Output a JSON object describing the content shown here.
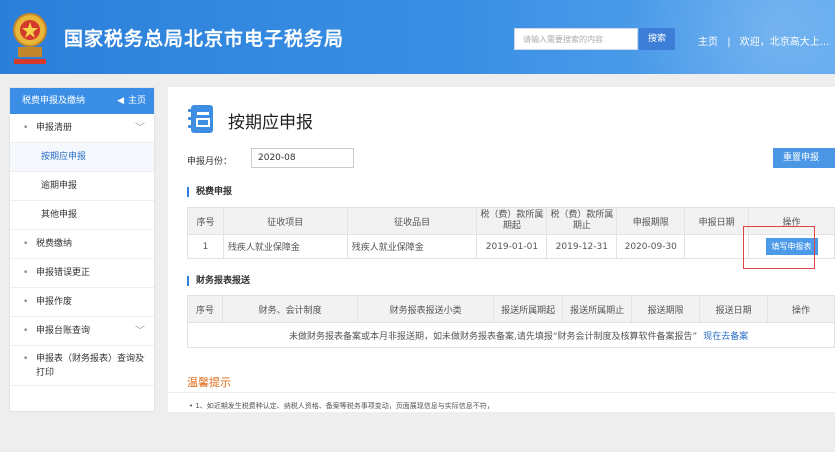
{
  "header": {
    "title": "国家税务总局北京市电子税务局",
    "search_placeholder": "请输入需要搜索的内容",
    "search_button": "搜索",
    "home_link": "主页",
    "separator": "|",
    "welcome": "欢迎，北京高大上...",
    "emblem_icon": "tax-emblem-icon"
  },
  "sidebar": {
    "head_label": "税费申报及缴纳",
    "home_label": "主页",
    "items": [
      {
        "label": "申报清册",
        "expanded": true
      },
      {
        "label": "按期应申报",
        "sub": true,
        "active": true
      },
      {
        "label": "逾期申报",
        "sub": true
      },
      {
        "label": "其他申报",
        "sub": true
      },
      {
        "label": "税费缴纳"
      },
      {
        "label": "申报错误更正"
      },
      {
        "label": "申报作废"
      },
      {
        "label": "申报台账查询"
      },
      {
        "label": "申报表（财务报表）查询及打印"
      }
    ]
  },
  "main": {
    "page_title": "按期应申报",
    "period_label": "申报月份：",
    "period_value": "2020-08",
    "reset_button": "重置申报",
    "tax_section_title": "税费申报",
    "tax_table": {
      "headers": [
        "序号",
        "征收项目",
        "征收品目",
        "税（费）款所属期起",
        "税（费）款所属期止",
        "申报期限",
        "申报日期",
        "操作"
      ],
      "rows": [
        {
          "no": "1",
          "item": "残疾人就业保障金",
          "subitem": "残疾人就业保障金",
          "start": "2019-01-01",
          "end": "2019-12-31",
          "deadline": "2020-09-30",
          "date": "",
          "action": "填写申报表"
        }
      ]
    },
    "fin_section_title": "财务报表报送",
    "fin_table": {
      "headers": [
        "序号",
        "财务、会计制度",
        "财务报表报送小类",
        "报送所属期起",
        "报送所属期止",
        "报送期限",
        "报送日期",
        "操作"
      ],
      "notice": "未做财务报表备案或本月非报送期，如未做财务报表备案,请先填报“财务会计制度及核算软件备案报告”",
      "notice_link": "现在去备案"
    },
    "tips_title": "温馨提示",
    "tips_text": "• 1、如近期发生税费种认定、纳税人资格、备案等税务事项变动，页面展现信息与实际信息不符，"
  },
  "colors": {
    "header_blue": "#2b7fd9",
    "accent_blue": "#3a8ee6",
    "highlight_red": "#e04343",
    "tips_orange": "#e06a1b"
  }
}
